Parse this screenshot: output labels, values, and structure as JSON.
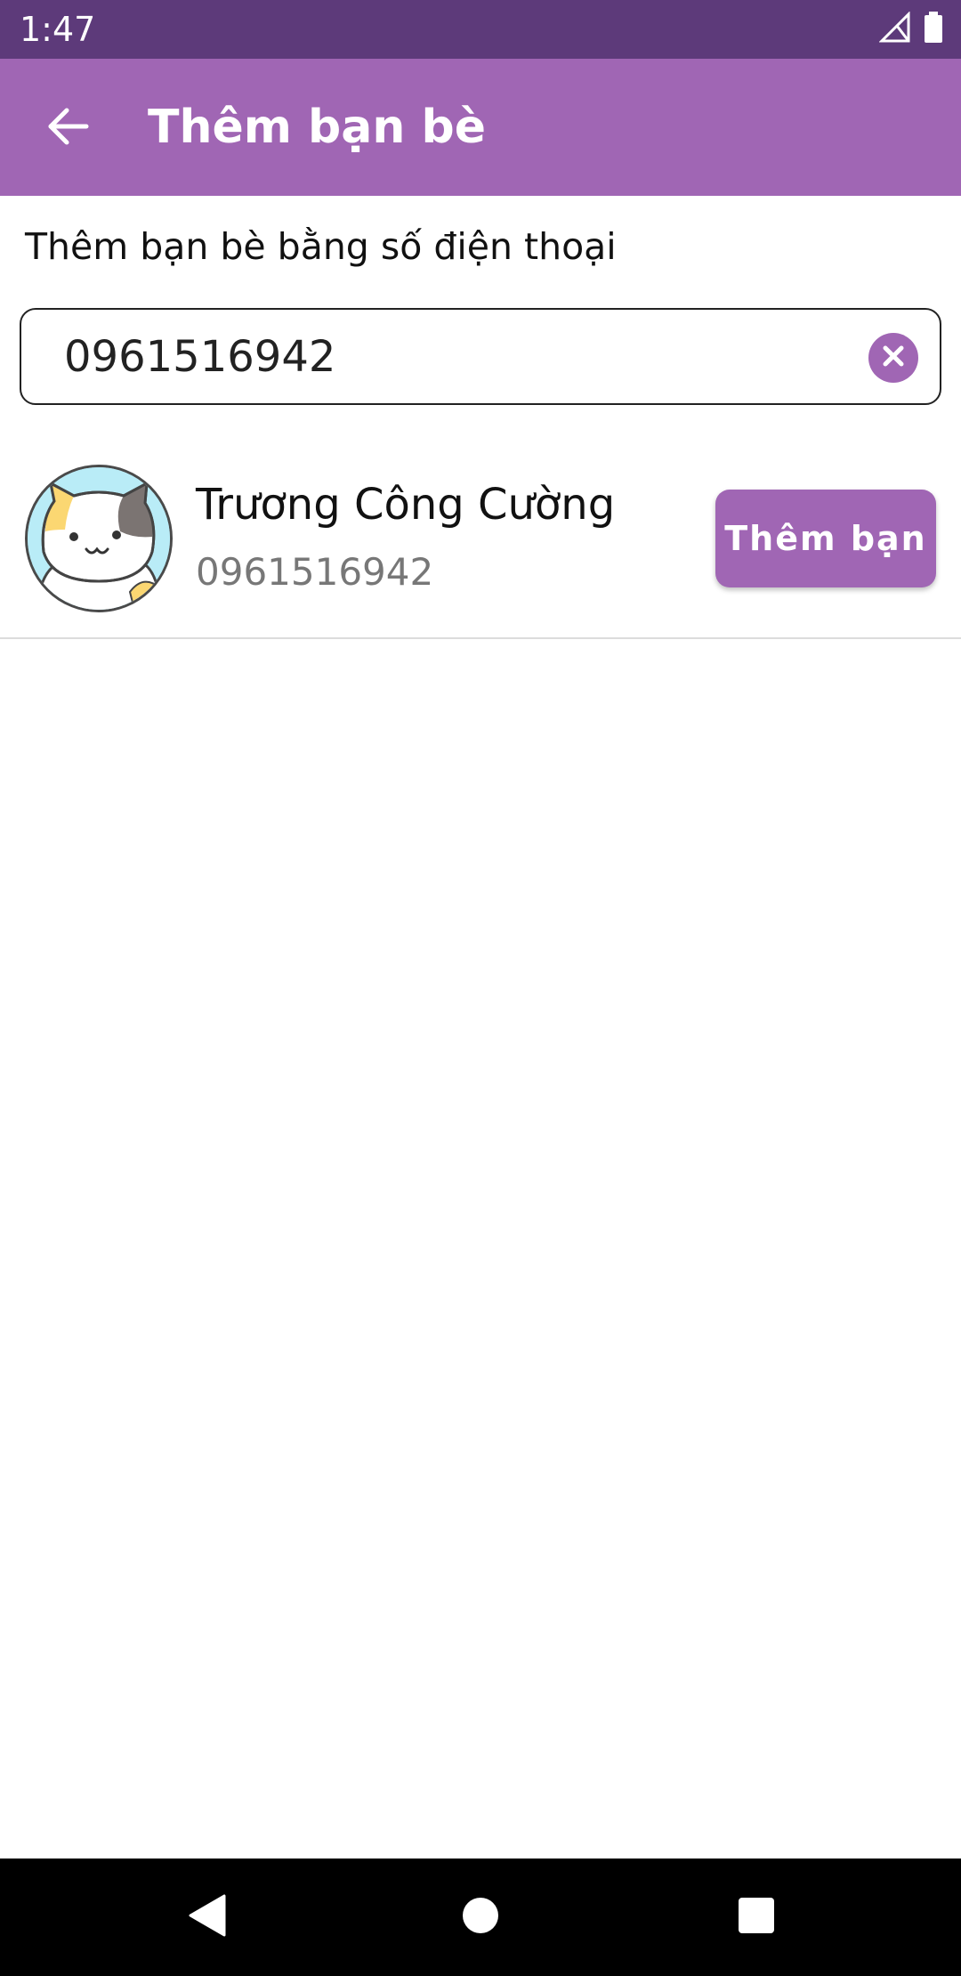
{
  "status_bar": {
    "time": "1:47",
    "icons": [
      "signal-icon",
      "battery-icon"
    ]
  },
  "app_bar": {
    "title": "Thêm bạn bè",
    "back_icon": "arrow-left-icon",
    "background_color": "#a066b4"
  },
  "section": {
    "label": "Thêm bạn bè bằng số điện thoại"
  },
  "search": {
    "value": "0961516942",
    "placeholder": "",
    "clear_icon": "close-circle-icon"
  },
  "results": [
    {
      "name": "Trương Công Cường",
      "phone": "0961516942",
      "avatar": "cat-avatar",
      "action_label": "Thêm bạn"
    }
  ],
  "nav_bar": {
    "icons": [
      "back-triangle-icon",
      "home-circle-icon",
      "recents-square-icon"
    ]
  },
  "colors": {
    "status_bar": "#5d3a7a",
    "accent": "#a066b4",
    "secondary_text": "#777777"
  }
}
